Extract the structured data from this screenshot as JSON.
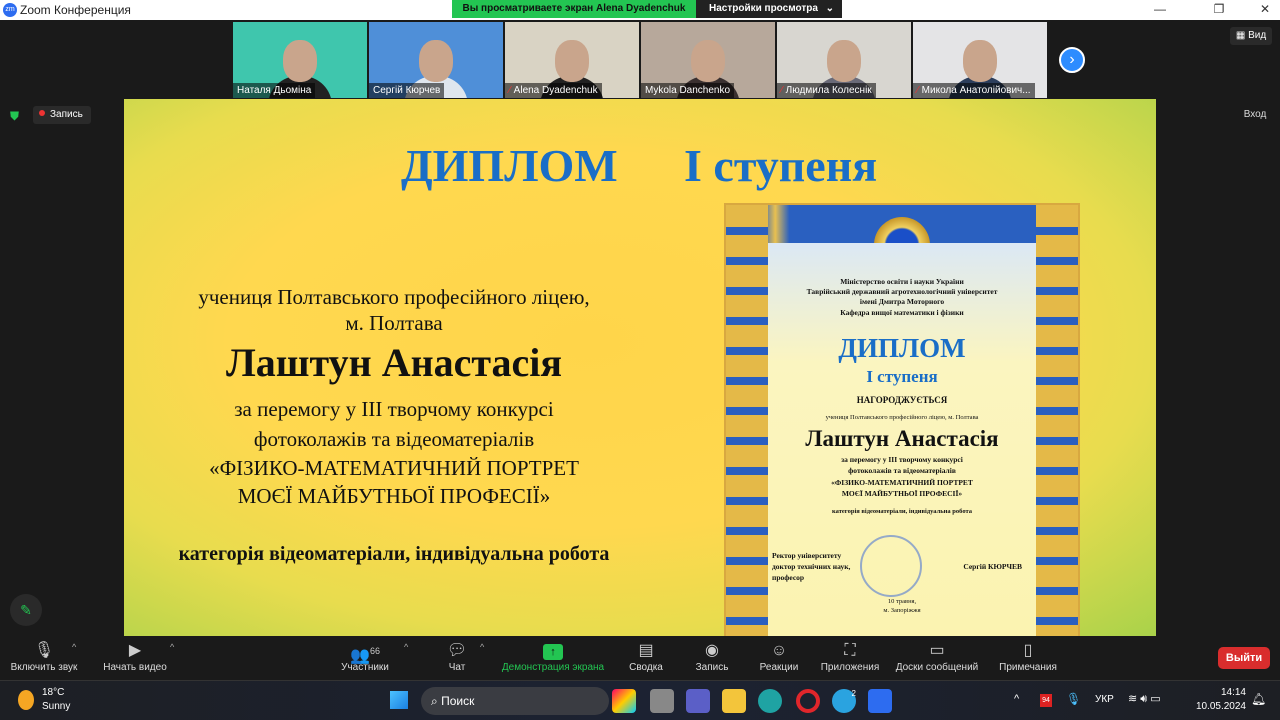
{
  "window": {
    "app_icon": "zm",
    "title": "Zoom Конференция",
    "banner": "Вы просматриваете экран Alena Dyadenchuk",
    "view_settings": "Настройки просмотра",
    "chevron": "⌄"
  },
  "participants": [
    {
      "name": "Наталя Дьоміна",
      "muted": false,
      "bg": "#3fc6ad",
      "shirt": "#222"
    },
    {
      "name": "Сергій Кюрчев",
      "muted": false,
      "bg": "#4f8fd8",
      "shirt": "#dfe6ee"
    },
    {
      "name": "Alena Dyadenchuk",
      "muted": true,
      "bg": "#d9d3c4",
      "shirt": "#222"
    },
    {
      "name": "Mykola Danchenko",
      "muted": false,
      "bg": "#b7a89b",
      "shirt": "#3a3030"
    },
    {
      "name": "Людмила Колеснік",
      "muted": true,
      "bg": "#d8d6d0",
      "shirt": "#6a6a78"
    },
    {
      "name": "Микола Анатолійович...",
      "muted": true,
      "bg": "#e4e4e6",
      "shirt": "#2c3e5c"
    }
  ],
  "view_button": "Вид",
  "record_badge": "Запись",
  "exit_label": "Вход",
  "slide": {
    "title_left": "ДИПЛОМ",
    "title_right": "І ступеня",
    "line1": "учениця Полтавського професійного ліцею,",
    "line2": "м. Полтава",
    "name": "Лаштун Анастасія",
    "line3": "за перемогу у ІІІ творчому конкурсі",
    "line4": "фотоколажів та відеоматеріалів",
    "line5": "«ФІЗИКО-МАТЕМАТИЧНИЙ ПОРТРЕТ",
    "line6": "МОЄЇ МАЙБУТНЬОЇ ПРОФЕСІЇ»",
    "category": "категорія відеоматеріали, індивідуальна робота"
  },
  "diploma": {
    "org1": "Міністерство освіти і науки України",
    "org2": "Таврійський державний агротехнологічний університет",
    "org3": "імені Дмитра Моторного",
    "org4": "Кафедра вищої математики і фізики",
    "title": "ДИПЛОМ",
    "degree": "І ступеня",
    "awarded": "НАГОРОДЖУЄТЬСЯ",
    "student": "учениця Полтавського професійного ліцею, м. Полтава",
    "name": "Лаштун Анастасія",
    "l1": "за перемогу у ІІІ творчому конкурсі",
    "l2": "фотоколажів та відеоматеріалів",
    "l3": "«ФІЗИКО-МАТЕМАТИЧНИЙ ПОРТРЕТ",
    "l4": "МОЄЇ МАЙБУТНЬОЇ ПРОФЕСІЇ»",
    "category": "категорія відеоматеріали, індивідуальна робота",
    "sign1": "Ректор університету",
    "sign2": "доктор технічних наук,",
    "sign3": "професор",
    "signer": "Сергій КЮРЧЕВ",
    "date": "10 травня,",
    "city": "м. Запоріжжя"
  },
  "toolbar": {
    "unmute": "Включить звук",
    "video": "Начать видео",
    "participants": "Участники",
    "participants_count": "66",
    "chat": "Чат",
    "share": "Демонстрация экрана",
    "summary": "Сводка",
    "record": "Запись",
    "reactions": "Реакции",
    "apps": "Приложения",
    "whiteboards": "Доски сообщений",
    "notes": "Примечания",
    "leave": "Выйти"
  },
  "taskbar": {
    "temp": "18°C",
    "weather": "Sunny",
    "search": "Поиск",
    "lang": "УКР",
    "time": "14:14",
    "date": "10.05.2024",
    "badge": "94",
    "telegram_count": "2"
  }
}
